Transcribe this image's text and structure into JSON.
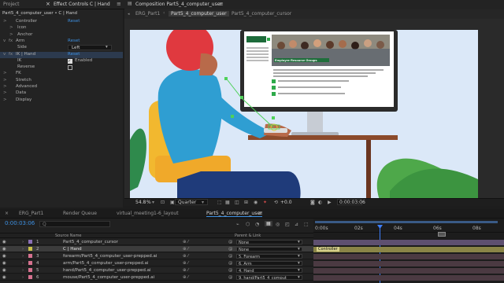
{
  "top": {
    "project_tab": "Project",
    "effect_controls_tab": "Effect Controls C | Hand",
    "comp_tab": "Composition Part5_4_computer_user",
    "menu_icon": "hamburger-icon",
    "close_icon": "close-icon"
  },
  "effect_controls": {
    "header": "Part5_4_computer_user • C | Hand",
    "rows": [
      {
        "label": "Controller",
        "value": "Reset",
        "indent": 0,
        "twirl": ">"
      },
      {
        "label": "Icon",
        "value": "",
        "indent": 1,
        "twirl": ">"
      },
      {
        "label": "Anchor",
        "value": "",
        "indent": 1,
        "twirl": ">"
      },
      {
        "label": "Arm",
        "value": "Reset",
        "indent": 0,
        "twirl": "v"
      },
      {
        "label": "Side",
        "value": "Left",
        "indent": 1,
        "twirl": ""
      },
      {
        "label": "IK | Hand",
        "value": "Reset",
        "indent": 0,
        "twirl": "v"
      },
      {
        "label": "IK",
        "value": "Enabled",
        "indent": 1,
        "twirl": ""
      },
      {
        "label": "Reverse",
        "value": "",
        "indent": 1,
        "twirl": ""
      },
      {
        "label": "FK",
        "value": "",
        "indent": 0,
        "twirl": ">"
      },
      {
        "label": "Stretch",
        "value": "",
        "indent": 0,
        "twirl": ">"
      },
      {
        "label": "Advanced",
        "value": "",
        "indent": 0,
        "twirl": ">"
      },
      {
        "label": "Data",
        "value": "",
        "indent": 0,
        "twirl": ">"
      },
      {
        "label": "Display",
        "value": "",
        "indent": 0,
        "twirl": ">"
      }
    ]
  },
  "comp": {
    "tabs": [
      "ERG_Part1",
      "Part5_4_computer_user",
      "Part5_4_computer_cursor"
    ],
    "active_tab": 1
  },
  "screen": {
    "logo_text": "Business Resource Groups",
    "headline": "Employee Resource Groups"
  },
  "viewer_bar": {
    "zoom": "54.8",
    "zoom_unit": "%",
    "resolution": "Quarter",
    "exposure": "+0.0",
    "timecode": "0:00:03:06"
  },
  "timeline": {
    "tabs": [
      "ERG_Part1",
      "Render Queue",
      "virtual_meeting1-6_layout",
      "Part5_4_computer_user"
    ],
    "active_tab": 3,
    "timecode": "0:00:03:06",
    "search_placeholder": "Q",
    "col_source": "Source Name",
    "col_parent": "Parent & Link",
    "ruler": [
      "0:00s",
      "02s",
      "04s",
      "06s",
      "08s"
    ],
    "layers": [
      {
        "num": "1",
        "name": "Part5_4_computer_cursor",
        "parent": "None",
        "color": "#8a6fb6",
        "selected": false
      },
      {
        "num": "2",
        "name": "C | Hand",
        "parent": "None",
        "color": "#c9c14a",
        "selected": true
      },
      {
        "num": "3",
        "name": "forearm/Part5_4_computer_user-prepped.ai",
        "parent": "5. Forearm",
        "color": "#d6718f",
        "selected": false
      },
      {
        "num": "4",
        "name": "arm/Part5_4_computer_user-prepped.ai",
        "parent": "6. Arm",
        "color": "#d6718f",
        "selected": false
      },
      {
        "num": "5",
        "name": "hand/Part5_4_computer_user-prepped.ai",
        "parent": "4. Hand",
        "color": "#d6718f",
        "selected": false
      },
      {
        "num": "6",
        "name": "mouse/Part5_4_computer_user-prepped.ai",
        "parent": "9. hand/Part5_4_comput",
        "color": "#d6718f",
        "selected": false
      }
    ],
    "keyframe_label": "Controller"
  },
  "colors": {
    "accent": "#2d8ceb",
    "playhead": "#3d7fff",
    "timecode": "#3d8fe0"
  }
}
